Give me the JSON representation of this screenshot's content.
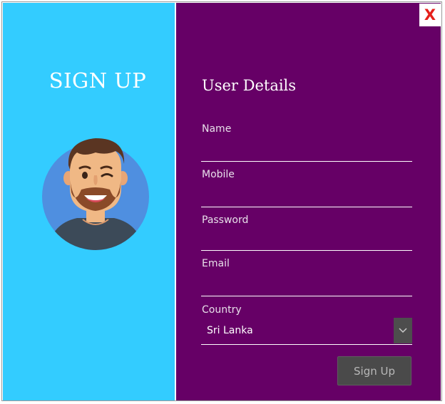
{
  "window": {
    "close_label": "X"
  },
  "left_panel": {
    "heading": "SIGN UP",
    "avatar_icon": "user-avatar-icon"
  },
  "form": {
    "title": "User Details",
    "fields": [
      {
        "label": "Name",
        "value": ""
      },
      {
        "label": "Mobile",
        "value": ""
      },
      {
        "label": "Password",
        "value": ""
      },
      {
        "label": "Email",
        "value": ""
      }
    ],
    "country": {
      "label": "Country",
      "selected": "Sri Lanka",
      "icon": "chevron-down-icon"
    },
    "submit_label": "Sign Up"
  },
  "colors": {
    "left_panel_bg": "#33ccff",
    "right_panel_bg": "#660066",
    "close_text": "#e5201b",
    "button_bg": "#4a4a4a"
  }
}
